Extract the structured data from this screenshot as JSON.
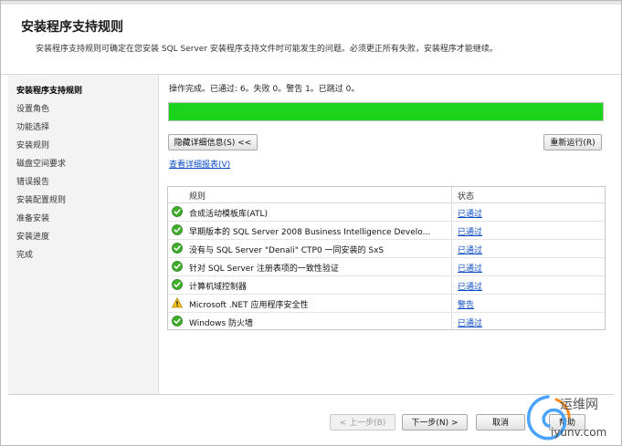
{
  "header": {
    "title": "安装程序支持规则",
    "description": "安装程序支持规则可确定在您安装 SQL Server 安装程序支持文件时可能发生的问题。必须更正所有失败，安装程序才能继续。"
  },
  "sidebar": {
    "items": [
      {
        "label": "安装程序支持规则",
        "active": true
      },
      {
        "label": "设置角色"
      },
      {
        "label": "功能选择"
      },
      {
        "label": "安装规则"
      },
      {
        "label": "磁盘空间要求"
      },
      {
        "label": "错误报告"
      },
      {
        "label": "安装配置规则"
      },
      {
        "label": "准备安装"
      },
      {
        "label": "安装进度"
      },
      {
        "label": "完成"
      }
    ]
  },
  "main": {
    "status_text": "操作完成。已通过: 6。失败 0。警告 1。已跳过 0。",
    "progress_fraction": 1.0,
    "progress_color": "#1cd41c",
    "hide_details_button": "隐藏详细信息(S) <<",
    "rerun_button": "重新运行(R)",
    "view_report_link": "查看详细报表(V)",
    "table": {
      "headers": {
        "rule": "规则",
        "status": "状态"
      },
      "rows": [
        {
          "icon": "pass-check-icon",
          "rule": "合成活动模板库(ATL)",
          "status": "已通过"
        },
        {
          "icon": "pass-check-icon",
          "rule": "早期版本的 SQL Server 2008 Business Intelligence Develo...",
          "status": "已通过"
        },
        {
          "icon": "pass-check-icon",
          "rule": "没有与 SQL Server \"Denali\" CTP0 一同安装的 SxS",
          "status": "已通过"
        },
        {
          "icon": "pass-check-icon",
          "rule": "针对 SQL Server 注册表项的一致性验证",
          "status": "已通过"
        },
        {
          "icon": "pass-check-icon",
          "rule": "计算机域控制器",
          "status": "已通过"
        },
        {
          "icon": "warning-triangle-icon",
          "rule": "Microsoft .NET 应用程序安全性",
          "status": "警告"
        },
        {
          "icon": "pass-check-icon",
          "rule": "Windows 防火墙",
          "status": "已通过"
        }
      ]
    }
  },
  "footer": {
    "back_button": "< 上一步(B)",
    "next_button": "下一步(N) >",
    "cancel_button": "取消",
    "help_button": "帮助"
  },
  "watermark": {
    "text_top": "运维网",
    "text_bottom": "iyunv.com"
  }
}
